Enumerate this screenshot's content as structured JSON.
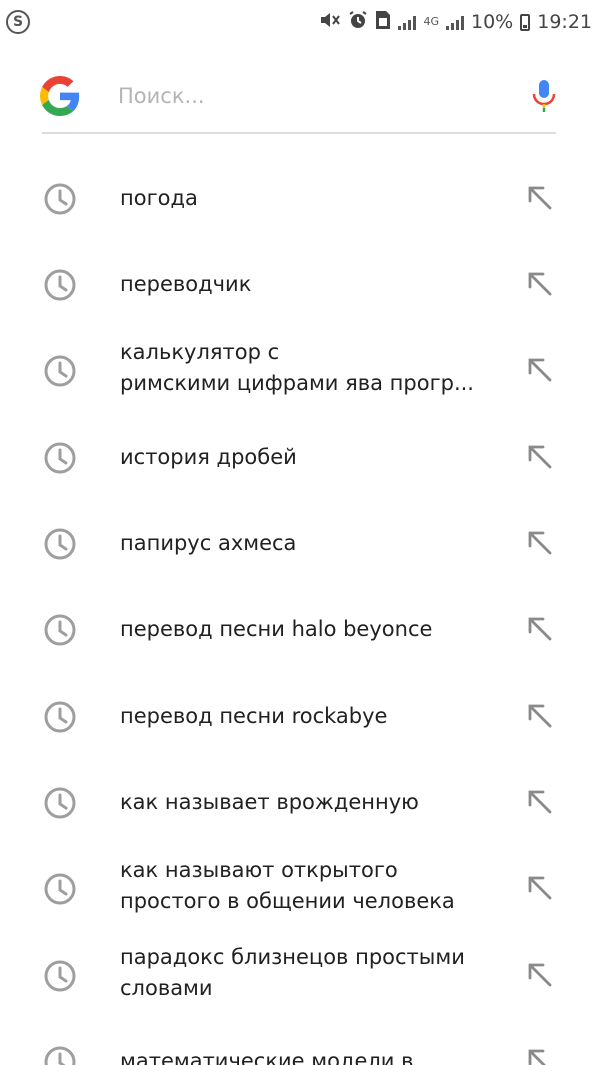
{
  "status_bar": {
    "left_icon": "skype-icon",
    "icons": [
      "mute-icon",
      "alarm-icon",
      "sim-card-icon",
      "signal-icon",
      "network-4g-icon",
      "signal-icon"
    ],
    "network_type": "4G",
    "battery_percent": "10%",
    "time": "19:21"
  },
  "search": {
    "placeholder": "Поиск...",
    "logo_icon": "google-logo",
    "voice_icon": "microphone-icon"
  },
  "colors": {
    "google_blue": "#4285F4",
    "google_red": "#EA4335",
    "google_yellow": "#FBBC05",
    "google_green": "#34A853",
    "icon_gray": "#9e9e9e"
  },
  "suggestions": [
    {
      "text": "погода"
    },
    {
      "text": "переводчик"
    },
    {
      "text": "калькулятор с\nримскими цифрами ява прогр..."
    },
    {
      "text": "история дробей"
    },
    {
      "text": "папирус ахмеса"
    },
    {
      "text": "перевод песни halo beyonce"
    },
    {
      "text": "перевод песни rockabye"
    },
    {
      "text": "как называет врожденную"
    },
    {
      "text": "как называют открытого\nпростого в общении человека"
    },
    {
      "text": "парадокс близнецов простыми\nсловами"
    },
    {
      "text": "математические модели в"
    }
  ]
}
